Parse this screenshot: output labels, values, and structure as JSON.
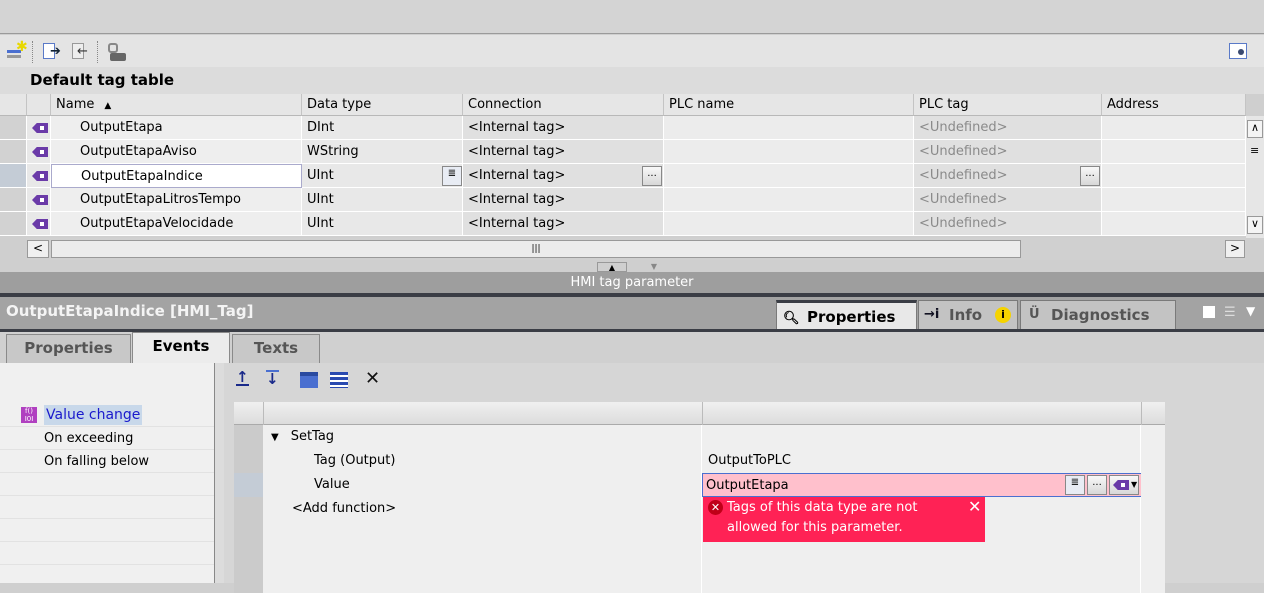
{
  "toolbar": {
    "icons": [
      "add-row-icon",
      "export-icon",
      "import-icon",
      "connection-icon"
    ],
    "right_icon": "overview-icon"
  },
  "table": {
    "title": "Default tag table",
    "columns": [
      "Name",
      "Data type",
      "Connection",
      "PLC name",
      "PLC tag",
      "Address"
    ],
    "rows": [
      {
        "name": "OutputEtapa",
        "type": "DInt",
        "connection": "<Internal tag>",
        "plc_name": "",
        "plc_tag": "<Undefined>",
        "address": ""
      },
      {
        "name": "OutputEtapaAviso",
        "type": "WString",
        "connection": "<Internal tag>",
        "plc_name": "",
        "plc_tag": "<Undefined>",
        "address": ""
      },
      {
        "name": "OutputEtapaIndice",
        "type": "UInt",
        "connection": "<Internal tag>",
        "plc_name": "",
        "plc_tag": "<Undefined>",
        "address": ""
      },
      {
        "name": "OutputEtapaLitrosTempo",
        "type": "UInt",
        "connection": "<Internal tag>",
        "plc_name": "",
        "plc_tag": "<Undefined>",
        "address": ""
      },
      {
        "name": "OutputEtapaVelocidade",
        "type": "UInt",
        "connection": "<Internal tag>",
        "plc_name": "",
        "plc_tag": "<Undefined>",
        "address": ""
      }
    ],
    "selected_row": 2,
    "ellipsis": "..."
  },
  "splitter_label": "HMI tag parameter",
  "inspector": {
    "title": "OutputEtapaIndice [HMI_Tag]",
    "right_tabs": [
      "Properties",
      "Info",
      "Diagnostics"
    ],
    "tabs": [
      "Properties",
      "Events",
      "Texts"
    ],
    "active_tab": "Events",
    "events": [
      "Value change",
      "On exceeding",
      "On falling below"
    ],
    "functions": {
      "name": "SetTag",
      "params": [
        {
          "label": "Tag (Output)",
          "value": "OutputToPLC"
        },
        {
          "label": "Value",
          "value": "OutputEtapa"
        }
      ],
      "add": "<Add function>"
    },
    "error": "Tags of this data type are not allowed for this parameter.",
    "error_color": "#ff2255",
    "ellipsis": "..."
  }
}
